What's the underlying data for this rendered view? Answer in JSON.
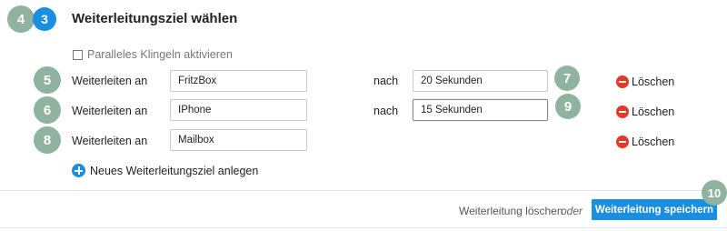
{
  "header": {
    "step_number": "3",
    "title": "Weiterleitungsziel wählen"
  },
  "badges": {
    "b4": "4",
    "b5": "5",
    "b6": "6",
    "b7": "7",
    "b8": "8",
    "b9": "9",
    "b10": "10"
  },
  "parallel_ringing": {
    "label": "Paralleles Klingeln aktivieren",
    "checked": false
  },
  "rows": [
    {
      "label": "Weiterleiten an",
      "target": "FritzBox",
      "after_label": "nach",
      "delay": "20 Sekunden",
      "delete_label": "Löschen"
    },
    {
      "label": "Weiterleiten an",
      "target": "IPhone",
      "after_label": "nach",
      "delay": "15 Sekunden",
      "delete_label": "Löschen"
    },
    {
      "label": "Weiterleiten an",
      "target": "Mailbox",
      "delete_label": "Löschen"
    }
  ],
  "add_target_label": "Neues Weiterleitungsziel anlegen",
  "footer": {
    "delete_link": "Weiterleitung löschen",
    "or_text": "oder",
    "save_button": "Weiterleitung speichern"
  },
  "colors": {
    "accent_blue": "#1a8ee0",
    "badge_green": "#8fb39f",
    "delete_red": "#e53826"
  }
}
